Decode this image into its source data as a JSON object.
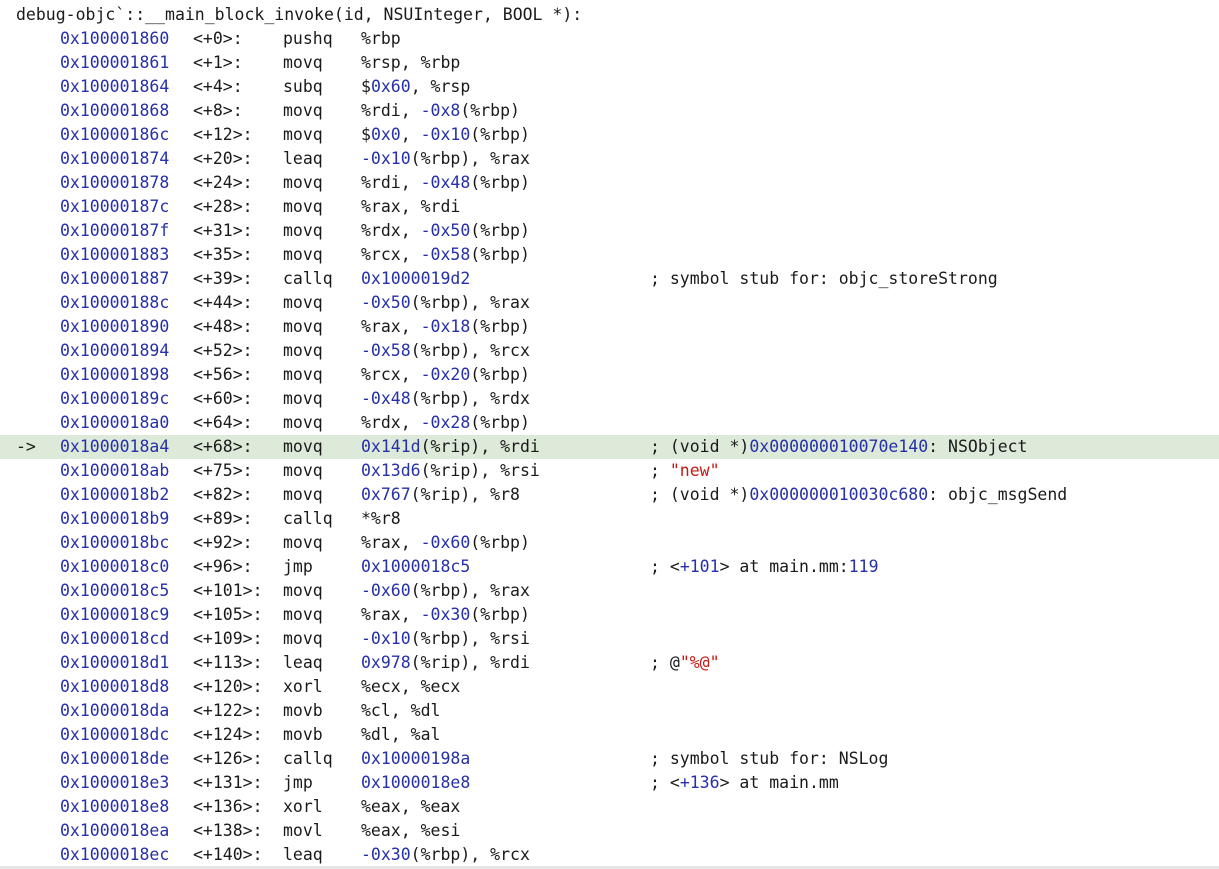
{
  "header": "debug-objc`::__main_block_invoke(id, NSUInteger, BOOL *):",
  "current_line_marker": "->",
  "lines": [
    {
      "addr": "0x100001860",
      "off": "<+0>:",
      "op": "pushq",
      "args": [
        {
          "t": "%rbp"
        }
      ],
      "cmt": []
    },
    {
      "addr": "0x100001861",
      "off": "<+1>:",
      "op": "movq",
      "args": [
        {
          "t": "%rsp, %rbp"
        }
      ],
      "cmt": []
    },
    {
      "addr": "0x100001864",
      "off": "<+4>:",
      "op": "subq",
      "args": [
        {
          "t": "$"
        },
        {
          "t": "0x60",
          "n": 1
        },
        {
          "t": ", %rsp"
        }
      ],
      "cmt": []
    },
    {
      "addr": "0x100001868",
      "off": "<+8>:",
      "op": "movq",
      "args": [
        {
          "t": "%rdi, "
        },
        {
          "t": "-0x8",
          "n": 1
        },
        {
          "t": "(%rbp)"
        }
      ],
      "cmt": []
    },
    {
      "addr": "0x10000186c",
      "off": "<+12>:",
      "op": "movq",
      "args": [
        {
          "t": "$"
        },
        {
          "t": "0x0",
          "n": 1
        },
        {
          "t": ", "
        },
        {
          "t": "-0x10",
          "n": 1
        },
        {
          "t": "(%rbp)"
        }
      ],
      "cmt": []
    },
    {
      "addr": "0x100001874",
      "off": "<+20>:",
      "op": "leaq",
      "args": [
        {
          "t": "-0x10",
          "n": 1
        },
        {
          "t": "(%rbp), %rax"
        }
      ],
      "cmt": []
    },
    {
      "addr": "0x100001878",
      "off": "<+24>:",
      "op": "movq",
      "args": [
        {
          "t": "%rdi, "
        },
        {
          "t": "-0x48",
          "n": 1
        },
        {
          "t": "(%rbp)"
        }
      ],
      "cmt": []
    },
    {
      "addr": "0x10000187c",
      "off": "<+28>:",
      "op": "movq",
      "args": [
        {
          "t": "%rax, %rdi"
        }
      ],
      "cmt": []
    },
    {
      "addr": "0x10000187f",
      "off": "<+31>:",
      "op": "movq",
      "args": [
        {
          "t": "%rdx, "
        },
        {
          "t": "-0x50",
          "n": 1
        },
        {
          "t": "(%rbp)"
        }
      ],
      "cmt": []
    },
    {
      "addr": "0x100001883",
      "off": "<+35>:",
      "op": "movq",
      "args": [
        {
          "t": "%rcx, "
        },
        {
          "t": "-0x58",
          "n": 1
        },
        {
          "t": "(%rbp)"
        }
      ],
      "cmt": []
    },
    {
      "addr": "0x100001887",
      "off": "<+39>:",
      "op": "callq",
      "args": [
        {
          "t": "0x1000019d2",
          "n": 1
        }
      ],
      "cmt": [
        {
          "t": "; symbol stub for: objc_storeStrong"
        }
      ]
    },
    {
      "addr": "0x10000188c",
      "off": "<+44>:",
      "op": "movq",
      "args": [
        {
          "t": "-0x50",
          "n": 1
        },
        {
          "t": "(%rbp), %rax"
        }
      ],
      "cmt": []
    },
    {
      "addr": "0x100001890",
      "off": "<+48>:",
      "op": "movq",
      "args": [
        {
          "t": "%rax, "
        },
        {
          "t": "-0x18",
          "n": 1
        },
        {
          "t": "(%rbp)"
        }
      ],
      "cmt": []
    },
    {
      "addr": "0x100001894",
      "off": "<+52>:",
      "op": "movq",
      "args": [
        {
          "t": "-0x58",
          "n": 1
        },
        {
          "t": "(%rbp), %rcx"
        }
      ],
      "cmt": []
    },
    {
      "addr": "0x100001898",
      "off": "<+56>:",
      "op": "movq",
      "args": [
        {
          "t": "%rcx, "
        },
        {
          "t": "-0x20",
          "n": 1
        },
        {
          "t": "(%rbp)"
        }
      ],
      "cmt": []
    },
    {
      "addr": "0x10000189c",
      "off": "<+60>:",
      "op": "movq",
      "args": [
        {
          "t": "-0x48",
          "n": 1
        },
        {
          "t": "(%rbp), %rdx"
        }
      ],
      "cmt": []
    },
    {
      "addr": "0x1000018a0",
      "off": "<+64>:",
      "op": "movq",
      "args": [
        {
          "t": "%rdx, "
        },
        {
          "t": "-0x28",
          "n": 1
        },
        {
          "t": "(%rbp)"
        }
      ],
      "cmt": []
    },
    {
      "addr": "0x1000018a4",
      "off": "<+68>:",
      "op": "movq",
      "args": [
        {
          "t": "0x141d",
          "n": 1
        },
        {
          "t": "(%rip), %rdi"
        }
      ],
      "cmt": [
        {
          "t": "; (void *)"
        },
        {
          "t": "0x000000010070e140",
          "n": 1
        },
        {
          "t": ": NSObject"
        }
      ],
      "current": true
    },
    {
      "addr": "0x1000018ab",
      "off": "<+75>:",
      "op": "movq",
      "args": [
        {
          "t": "0x13d6",
          "n": 1
        },
        {
          "t": "(%rip), %rsi"
        }
      ],
      "cmt": [
        {
          "t": "; "
        },
        {
          "t": "\"new\"",
          "s": 1
        }
      ]
    },
    {
      "addr": "0x1000018b2",
      "off": "<+82>:",
      "op": "movq",
      "args": [
        {
          "t": "0x767",
          "n": 1
        },
        {
          "t": "(%rip), %r8"
        }
      ],
      "cmt": [
        {
          "t": "; (void *)"
        },
        {
          "t": "0x000000010030c680",
          "n": 1
        },
        {
          "t": ": objc_msgSend"
        }
      ]
    },
    {
      "addr": "0x1000018b9",
      "off": "<+89>:",
      "op": "callq",
      "args": [
        {
          "t": "*%r8"
        }
      ],
      "cmt": []
    },
    {
      "addr": "0x1000018bc",
      "off": "<+92>:",
      "op": "movq",
      "args": [
        {
          "t": "%rax, "
        },
        {
          "t": "-0x60",
          "n": 1
        },
        {
          "t": "(%rbp)"
        }
      ],
      "cmt": []
    },
    {
      "addr": "0x1000018c0",
      "off": "<+96>:",
      "op": "jmp",
      "args": [
        {
          "t": "0x1000018c5",
          "n": 1
        }
      ],
      "cmt": [
        {
          "t": "; <"
        },
        {
          "t": "+101",
          "n": 1
        },
        {
          "t": "> at main.mm:"
        },
        {
          "t": "119",
          "n": 1
        }
      ]
    },
    {
      "addr": "0x1000018c5",
      "off": "<+101>:",
      "op": "movq",
      "args": [
        {
          "t": "-0x60",
          "n": 1
        },
        {
          "t": "(%rbp), %rax"
        }
      ],
      "cmt": []
    },
    {
      "addr": "0x1000018c9",
      "off": "<+105>:",
      "op": "movq",
      "args": [
        {
          "t": "%rax, "
        },
        {
          "t": "-0x30",
          "n": 1
        },
        {
          "t": "(%rbp)"
        }
      ],
      "cmt": []
    },
    {
      "addr": "0x1000018cd",
      "off": "<+109>:",
      "op": "movq",
      "args": [
        {
          "t": "-0x10",
          "n": 1
        },
        {
          "t": "(%rbp), %rsi"
        }
      ],
      "cmt": []
    },
    {
      "addr": "0x1000018d1",
      "off": "<+113>:",
      "op": "leaq",
      "args": [
        {
          "t": "0x978",
          "n": 1
        },
        {
          "t": "(%rip), %rdi"
        }
      ],
      "cmt": [
        {
          "t": "; @"
        },
        {
          "t": "\"%@\"",
          "s": 1
        }
      ]
    },
    {
      "addr": "0x1000018d8",
      "off": "<+120>:",
      "op": "xorl",
      "args": [
        {
          "t": "%ecx, %ecx"
        }
      ],
      "cmt": []
    },
    {
      "addr": "0x1000018da",
      "off": "<+122>:",
      "op": "movb",
      "args": [
        {
          "t": "%cl, %dl"
        }
      ],
      "cmt": []
    },
    {
      "addr": "0x1000018dc",
      "off": "<+124>:",
      "op": "movb",
      "args": [
        {
          "t": "%dl, %al"
        }
      ],
      "cmt": []
    },
    {
      "addr": "0x1000018de",
      "off": "<+126>:",
      "op": "callq",
      "args": [
        {
          "t": "0x10000198a",
          "n": 1
        }
      ],
      "cmt": [
        {
          "t": "; symbol stub for: NSLog"
        }
      ]
    },
    {
      "addr": "0x1000018e3",
      "off": "<+131>:",
      "op": "jmp",
      "args": [
        {
          "t": "0x1000018e8",
          "n": 1
        }
      ],
      "cmt": [
        {
          "t": "; <"
        },
        {
          "t": "+136",
          "n": 1
        },
        {
          "t": "> at main.mm"
        }
      ]
    },
    {
      "addr": "0x1000018e8",
      "off": "<+136>:",
      "op": "xorl",
      "args": [
        {
          "t": "%eax, %eax"
        }
      ],
      "cmt": []
    },
    {
      "addr": "0x1000018ea",
      "off": "<+138>:",
      "op": "movl",
      "args": [
        {
          "t": "%eax, %esi"
        }
      ],
      "cmt": []
    },
    {
      "addr": "0x1000018ec",
      "off": "<+140>:",
      "op": "leaq",
      "args": [
        {
          "t": "-0x30",
          "n": 1
        },
        {
          "t": "(%rbp), %rcx"
        }
      ],
      "cmt": []
    }
  ],
  "colors": {
    "address": "#2630a8",
    "number": "#2630a8",
    "string": "#c41a16",
    "text": "#1a1a1a",
    "current_line_bg": "#dde9d9"
  }
}
